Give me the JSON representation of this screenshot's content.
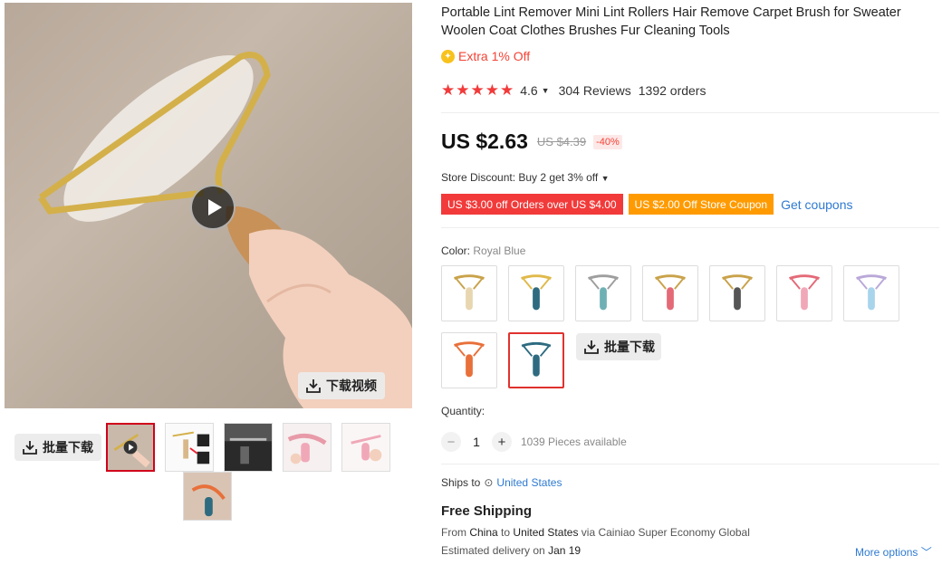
{
  "product": {
    "title": "Portable Lint Remover Mini Lint Rollers Hair Remove Carpet Brush for Sweater Woolen Coat Clothes Brushes Fur Cleaning Tools",
    "extra_off": "Extra 1% Off",
    "rating": "4.6",
    "stars": "★★★★★",
    "reviews": "304 Reviews",
    "orders": "1392 orders",
    "price": "US $2.63",
    "old_price": "US $4.39",
    "discount": "-40%",
    "store_discount": "Store Discount: Buy 2 get 3% off",
    "coupons": [
      "US $3.00 off Orders over US $4.00",
      "US $2.00 Off Store Coupon"
    ],
    "get_coupons": "Get coupons",
    "color_label": "Color:",
    "color_value": "Royal Blue",
    "color_options": [
      {
        "handle": "#e8d6b0",
        "frame": "#c9a24a"
      },
      {
        "handle": "#2e6b80",
        "frame": "#e0b94a"
      },
      {
        "handle": "#6fb0b5",
        "frame": "#9e9e9e"
      },
      {
        "handle": "#e46a78",
        "frame": "#c9a24a"
      },
      {
        "handle": "#555555",
        "frame": "#c9a24a"
      },
      {
        "handle": "#f0a8b8",
        "frame": "#e46a78"
      },
      {
        "handle": "#a8d4ec",
        "frame": "#b9a8d8"
      },
      {
        "handle": "#e8703a",
        "frame": "#e8703a"
      },
      {
        "handle": "#2e6b80",
        "frame": "#2e6b80"
      }
    ],
    "quantity_label": "Quantity:",
    "quantity_value": "1",
    "available": "1039 Pieces available",
    "ships_to_label": "Ships to",
    "ships_to_country": "United States",
    "free_shipping": "Free Shipping",
    "route_from": "From",
    "route_origin": "China",
    "route_to": "to",
    "route_dest": "United States",
    "route_via": "via Cainiao Super Economy Global",
    "delivery_label": "Estimated delivery on",
    "delivery_date": "Jan 19",
    "more_options": "More options"
  },
  "media": {
    "download_video": "下载视频",
    "batch_download": "批量下载",
    "thumbnails": [
      "video",
      "detail",
      "dark",
      "pink-sweater",
      "pink-hand",
      "blue"
    ]
  },
  "colors": {
    "accent_red": "#f23a3a",
    "accent_orange": "#ff9b00",
    "link_blue": "#2e7ad1",
    "selected_border": "#e0322e"
  }
}
